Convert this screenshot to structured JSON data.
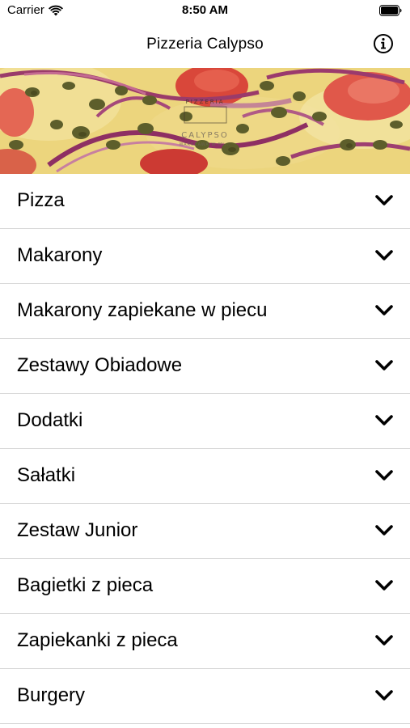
{
  "status_bar": {
    "carrier": "Carrier",
    "time": "8:50 AM",
    "icons": [
      "wifi-icon",
      "battery-icon"
    ]
  },
  "nav": {
    "title": "Pizzeria Calypso",
    "info_icon": "info-icon"
  },
  "banner": {
    "brand_top": "PIZZERIA",
    "brand_main": "CALYPSO",
    "brand_sub": "WARSZAWA W MI..."
  },
  "menu": {
    "items": [
      {
        "label": "Pizza"
      },
      {
        "label": "Makarony"
      },
      {
        "label": "Makarony zapiekane w piecu"
      },
      {
        "label": "Zestawy Obiadowe"
      },
      {
        "label": "Dodatki"
      },
      {
        "label": "Sałatki"
      },
      {
        "label": "Zestaw Junior"
      },
      {
        "label": "Bagietki z pieca"
      },
      {
        "label": "Zapiekanki z pieca"
      },
      {
        "label": "Burgery"
      }
    ],
    "chevron_icon": "chevron-down-icon"
  },
  "colors": {
    "background": "#ffffff",
    "separator": "#d9d9d9",
    "text": "#000000"
  }
}
